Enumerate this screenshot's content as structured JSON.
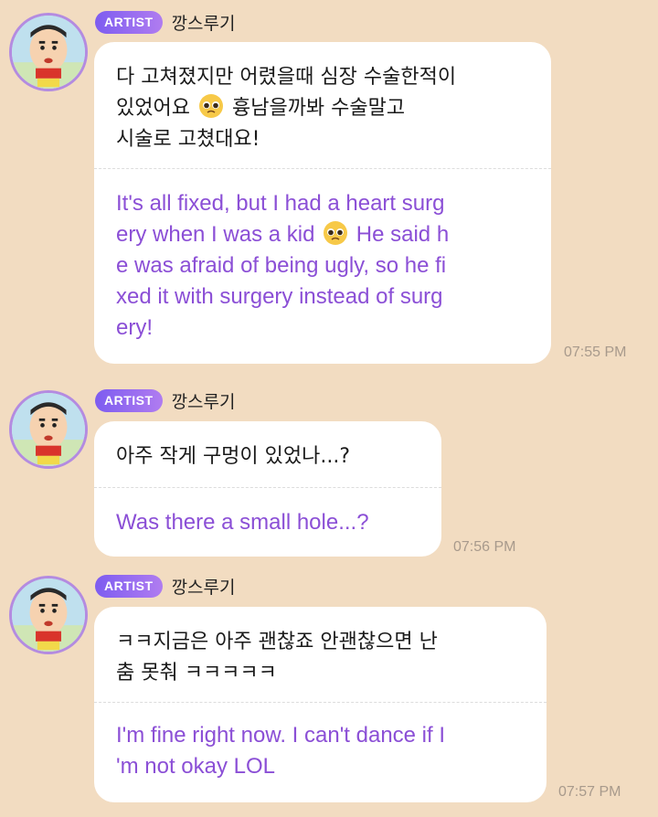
{
  "messages": [
    {
      "badge": "ARTIST",
      "name": "깡스루기",
      "original_lines": [
        "다 고쳐졌지만 어렸을때 심장 수술한적이",
        "있었어요 [emoji] 흉남을까봐 수술말고",
        "시술로 고쳤대요!"
      ],
      "original_part1": "다 고쳐졌지만 어렸을때 심장 수술한적이\n있었어요",
      "original_part2": "흉남을까봐 수술말고\n시술로 고쳤대요!",
      "translation_part1": "It's all fixed, but I had a heart surg\nery when I was a kid",
      "translation_part2": "He said h\ne was afraid of being ugly, so he fi\nxed it with surgery instead of surg\nery!",
      "emoji": "pleading-face-icon",
      "time": "07:55 PM"
    },
    {
      "badge": "ARTIST",
      "name": "깡스루기",
      "original": "아주 작게 구멍이 있었나...?",
      "translation": "Was there a small hole...?",
      "time": "07:56 PM"
    },
    {
      "badge": "ARTIST",
      "name": "깡스루기",
      "original": "ㅋㅋ지금은 아주 괜찮죠 안괜찮으면 난\n춤 못춰 ㅋㅋㅋㅋㅋ",
      "translation": "I'm fine right now. I can't dance if I\n'm not okay LOL",
      "time": "07:57 PM"
    }
  ],
  "colors": {
    "background": "#f2dcc1",
    "translation_text": "#8b4fd6",
    "badge_start": "#7d5cf0",
    "badge_end": "#b07cf0",
    "avatar_ring": "#b48be0"
  }
}
